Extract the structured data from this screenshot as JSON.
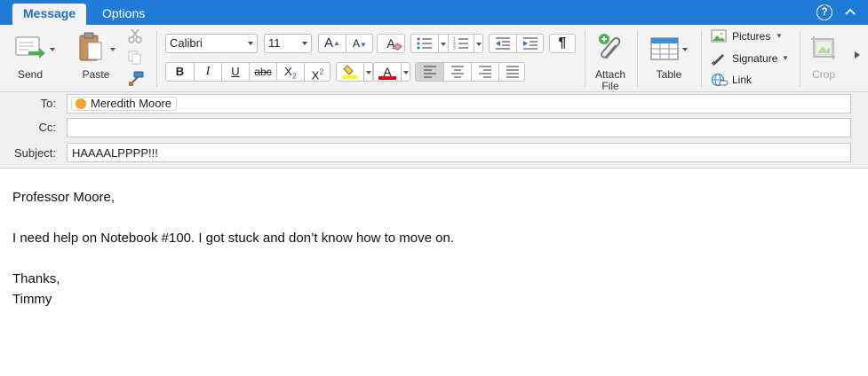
{
  "tabs": [
    {
      "label": "Message",
      "active": true
    },
    {
      "label": "Options",
      "active": false
    }
  ],
  "help_icon_glyph": "?",
  "ribbon": {
    "send_label": "Send",
    "paste_label": "Paste",
    "font_name": "Calibri",
    "font_size": "11",
    "grow_font_glyph": "A",
    "shrink_font_glyph": "A",
    "clear_format_glyph": "A",
    "bold_glyph": "B",
    "italic_glyph": "I",
    "underline_glyph": "U",
    "strike_glyph": "abc",
    "subscript_glyph": "X",
    "subscript_mark": "2",
    "superscript_glyph": "X",
    "superscript_mark": "2",
    "font_color_glyph": "A",
    "pilcrow_glyph": "¶",
    "attach_label_1": "Attach",
    "attach_label_2": "File",
    "table_label": "Table",
    "pictures_label": "Pictures",
    "signature_label": "Signature",
    "link_label": "Link",
    "crop_label": "Crop",
    "colors": {
      "highlight": "#ffff00",
      "font_color": "#e0001a",
      "accent": "#1f7bd6"
    }
  },
  "header": {
    "to_label": "To:",
    "to_recipients": [
      "Meredith Moore"
    ],
    "cc_label": "Cc:",
    "cc_value": "",
    "subject_label": "Subject:",
    "subject_value": "HAAAALPPPP!!!"
  },
  "body_lines": [
    "Professor Moore,",
    "",
    "I need help on Notebook #100. I got stuck and don’t know how to move on.",
    "",
    "Thanks,",
    "Timmy"
  ]
}
